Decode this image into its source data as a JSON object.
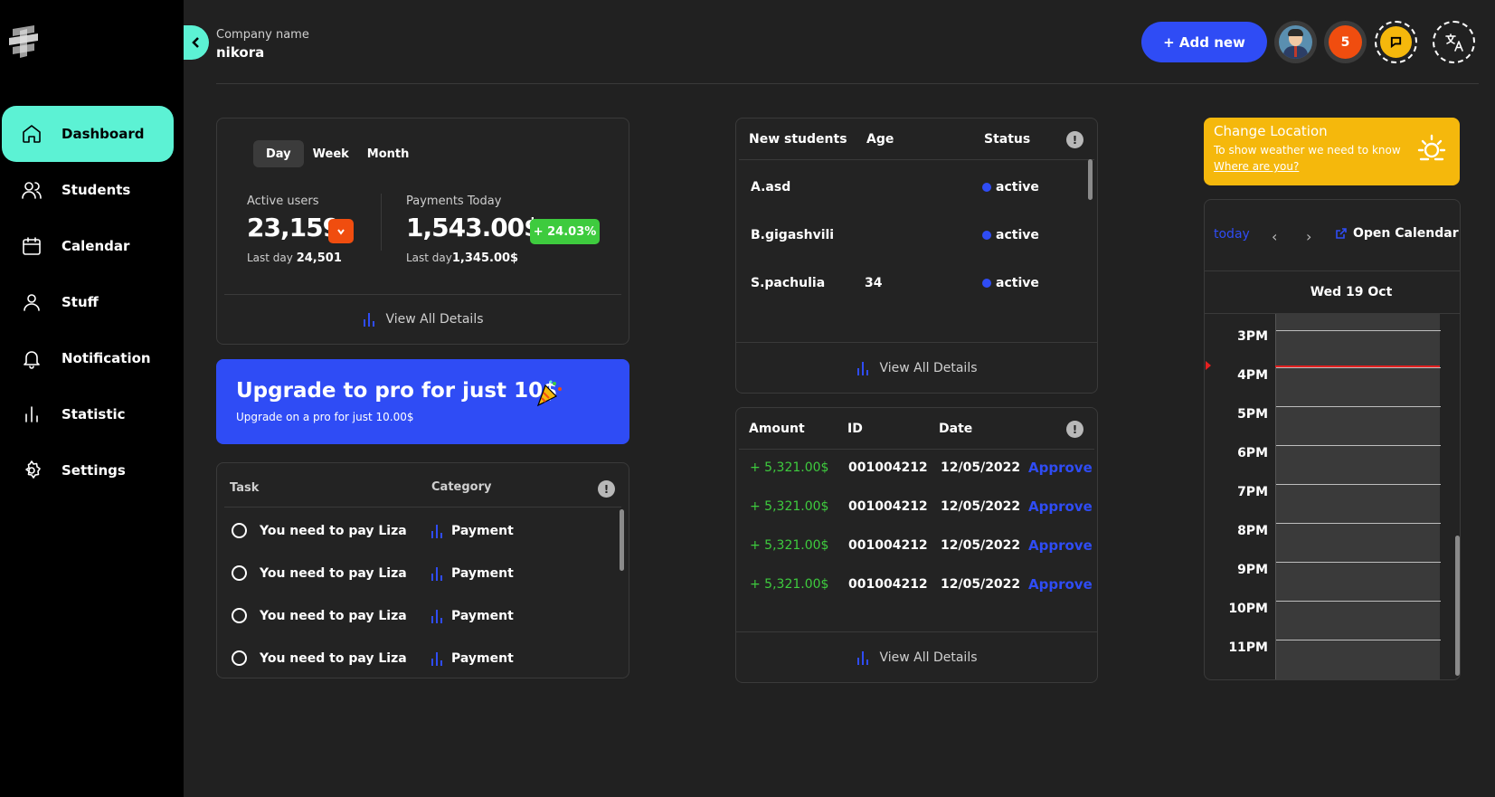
{
  "sidebar": {
    "items": [
      {
        "label": "Dashboard",
        "icon": "home-icon",
        "active": true
      },
      {
        "label": "Students",
        "icon": "users-icon"
      },
      {
        "label": "Calendar",
        "icon": "calendar-icon"
      },
      {
        "label": "Stuff",
        "icon": "user-icon"
      },
      {
        "label": "Notification",
        "icon": "bell-icon"
      },
      {
        "label": "Statistic",
        "icon": "bar-chart-icon"
      },
      {
        "label": "Settings",
        "icon": "gear-icon"
      }
    ]
  },
  "header": {
    "company_label": "Company name",
    "company_name": "nikora",
    "add_button": "+ Add new",
    "notification_count": "5"
  },
  "stats": {
    "tabs": [
      "Day",
      "Week",
      "Month"
    ],
    "active_tab": "Day",
    "active_users_label": "Active users",
    "active_users_value": "23,159",
    "active_users_last_label": "Last day",
    "active_users_last_value": "24,501",
    "payments_label": "Payments Today",
    "payments_value": "1,543.00$",
    "payments_change": "+ 24.03%",
    "payments_last_label": "Last day",
    "payments_last_value": "1,345.00$",
    "view_all": "View All Details"
  },
  "promo": {
    "title": "Upgrade to pro for just 10$",
    "subtitle": "Upgrade on a pro for just 10.00$"
  },
  "tasks": {
    "headers": {
      "task": "Task",
      "category": "Category"
    },
    "rows": [
      {
        "task": "You need to pay Liza",
        "category": "Payment"
      },
      {
        "task": "You need to pay Liza",
        "category": "Payment"
      },
      {
        "task": "You need to pay Liza",
        "category": "Payment"
      },
      {
        "task": "You need to pay Liza",
        "category": "Payment"
      }
    ]
  },
  "students": {
    "headers": {
      "name": "New students",
      "age": "Age",
      "status": "Status"
    },
    "rows": [
      {
        "name": "A.asd",
        "age": "",
        "status": "active"
      },
      {
        "name": "B.gigashvili",
        "age": "",
        "status": "active"
      },
      {
        "name": "S.pachulia",
        "age": "34",
        "status": "active"
      }
    ],
    "view_all": "View All Details"
  },
  "payments": {
    "headers": {
      "amount": "Amount",
      "id": "ID",
      "date": "Date"
    },
    "rows": [
      {
        "amount": "+ 5,321.00$",
        "id": "001004212",
        "date": "12/05/2022",
        "action": "Approve"
      },
      {
        "amount": "+ 5,321.00$",
        "id": "001004212",
        "date": "12/05/2022",
        "action": "Approve"
      },
      {
        "amount": "+ 5,321.00$",
        "id": "001004212",
        "date": "12/05/2022",
        "action": "Approve"
      },
      {
        "amount": "+ 5,321.00$",
        "id": "001004212",
        "date": "12/05/2022",
        "action": "Approve"
      }
    ],
    "view_all": "View All Details"
  },
  "weather": {
    "title": "Change Location",
    "subtitle": "To show weather we need to know",
    "link": "Where are you?"
  },
  "calendar": {
    "today": "today",
    "prev": "‹",
    "next": "›",
    "open": "Open Calendar",
    "day_label": "Wed 19 Oct",
    "hours": [
      "3PM",
      "4PM",
      "5PM",
      "6PM",
      "7PM",
      "8PM",
      "9PM",
      "10PM",
      "11PM"
    ]
  },
  "colors": {
    "accent": "#5cf2d4",
    "primary": "#2f4cf5",
    "warning": "#f5b80c",
    "danger": "#f04d0f",
    "success": "#3ecb3e"
  }
}
